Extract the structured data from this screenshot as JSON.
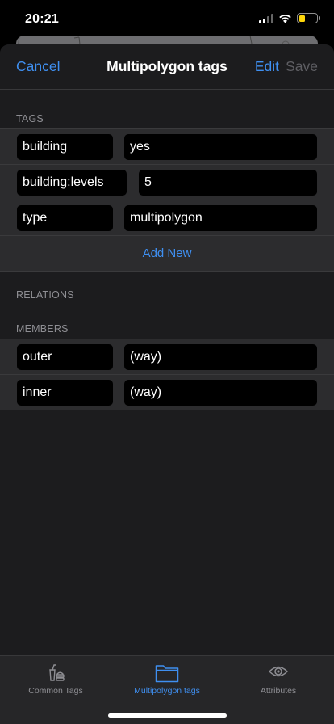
{
  "status_bar": {
    "time": "20:21",
    "battery_level": 0.35
  },
  "nav": {
    "cancel": "Cancel",
    "title": "Multipolygon tags",
    "edit": "Edit",
    "save": "Save"
  },
  "sections": {
    "tags": "TAGS",
    "relations": "RELATIONS",
    "members": "MEMBERS"
  },
  "tags": [
    {
      "key": "building",
      "value": "yes"
    },
    {
      "key": "building:levels",
      "value": "5"
    },
    {
      "key": "type",
      "value": "multipolygon"
    }
  ],
  "add_new": "Add New",
  "members": [
    {
      "role": "outer",
      "value": "(way)"
    },
    {
      "role": "inner",
      "value": "(way)"
    }
  ],
  "tabs": [
    {
      "label": "Common Tags",
      "icon": "common-tags-icon"
    },
    {
      "label": "Multipolygon tags",
      "icon": "folder-icon"
    },
    {
      "label": "Attributes",
      "icon": "eye-icon"
    }
  ],
  "colors": {
    "accent": "#3f8ff0",
    "disabled": "#5e5e63",
    "background": "#1c1c1e",
    "cell": "#2c2c2e"
  }
}
